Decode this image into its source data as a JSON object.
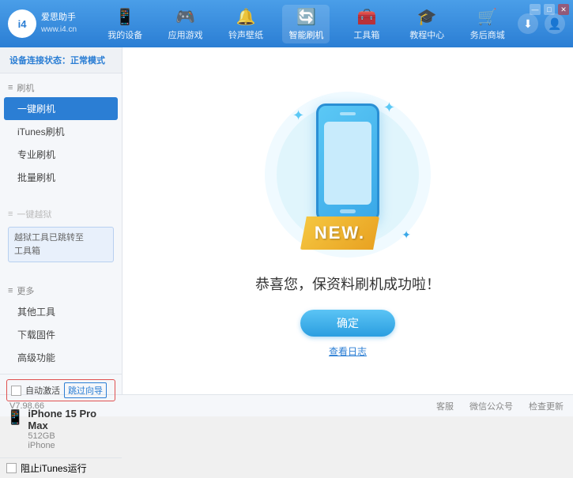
{
  "app": {
    "title": "爱思助手",
    "subtitle": "www.i4.cn"
  },
  "window_controls": {
    "minimize": "—",
    "maximize": "□",
    "close": "✕"
  },
  "nav": {
    "items": [
      {
        "id": "my-device",
        "label": "我的设备",
        "icon": "📱"
      },
      {
        "id": "app-game",
        "label": "应用游戏",
        "icon": "👤"
      },
      {
        "id": "ringtone",
        "label": "铃声壁纸",
        "icon": "🔔"
      },
      {
        "id": "smart-flash",
        "label": "智能刷机",
        "icon": "🔄",
        "active": true
      },
      {
        "id": "toolbox",
        "label": "工具箱",
        "icon": "🧰"
      },
      {
        "id": "tutorial",
        "label": "教程中心",
        "icon": "🎓"
      },
      {
        "id": "service",
        "label": "务后商城",
        "icon": "🛍️"
      }
    ]
  },
  "header_right": {
    "download_icon": "⬇",
    "user_icon": "👤"
  },
  "sidebar": {
    "status_label": "设备连接状态：",
    "status_value": "正常模式",
    "sections": [
      {
        "title": "刷机",
        "icon": "≡",
        "items": [
          {
            "id": "one-key-flash",
            "label": "一键刷机",
            "active": true
          },
          {
            "id": "itunes-flash",
            "label": "iTunes刷机"
          },
          {
            "id": "pro-flash",
            "label": "专业刷机"
          },
          {
            "id": "batch-flash",
            "label": "批量刷机"
          }
        ]
      },
      {
        "title": "一键越狱",
        "icon": "≡",
        "disabled": true,
        "notice": "越狱工具已跳转至\n工具箱"
      }
    ],
    "more_section": {
      "title": "更多",
      "icon": "≡",
      "items": [
        {
          "id": "other-tools",
          "label": "其他工具"
        },
        {
          "id": "download-firm",
          "label": "下载固件"
        },
        {
          "id": "advanced",
          "label": "高级功能"
        }
      ]
    }
  },
  "device": {
    "auto_activate_label": "自动激活",
    "guide_btn_label": "跳过向导",
    "name": "iPhone 15 Pro Max",
    "storage": "512GB",
    "type": "iPhone",
    "phone_icon": "📱"
  },
  "itunes": {
    "checkbox_label": "阻止iTunes运行"
  },
  "content": {
    "new_badge": "NEW.",
    "success_text": "恭喜您，保资料刷机成功啦！",
    "confirm_btn": "确定",
    "log_link": "查看日志"
  },
  "footer": {
    "version": "V7.98.66",
    "items": [
      {
        "id": "feedback",
        "label": "客服"
      },
      {
        "id": "wechat",
        "label": "微信公众号"
      },
      {
        "id": "check-update",
        "label": "检查更新"
      }
    ]
  }
}
